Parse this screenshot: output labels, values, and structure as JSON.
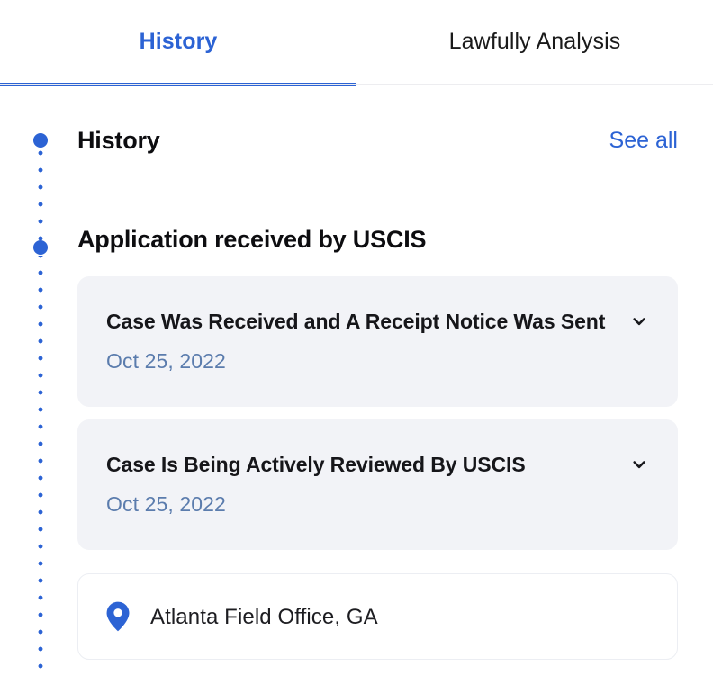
{
  "theme": {
    "accent": "#2c63d4",
    "card_bg": "#f2f3f7",
    "card_border": "#eceef3",
    "date_color": "#5b7cad",
    "text_color": "#0d0d10"
  },
  "tabs": [
    {
      "label": "History",
      "active": true
    },
    {
      "label": "Lawfully Analysis",
      "active": false
    }
  ],
  "history": {
    "section_title": "History",
    "see_all_label": "See all",
    "group_title": "Application received by USCIS",
    "events": [
      {
        "title": "Case Was Received and A Receipt Notice Was Sent",
        "date": "Oct 25, 2022",
        "expand_icon": "chevron-down-icon"
      },
      {
        "title": "Case Is Being Actively Reviewed By USCIS",
        "date": "Oct 25, 2022",
        "expand_icon": "chevron-down-icon"
      }
    ],
    "office": {
      "icon": "map-pin-icon",
      "name": "Atlanta Field Office, GA"
    }
  }
}
